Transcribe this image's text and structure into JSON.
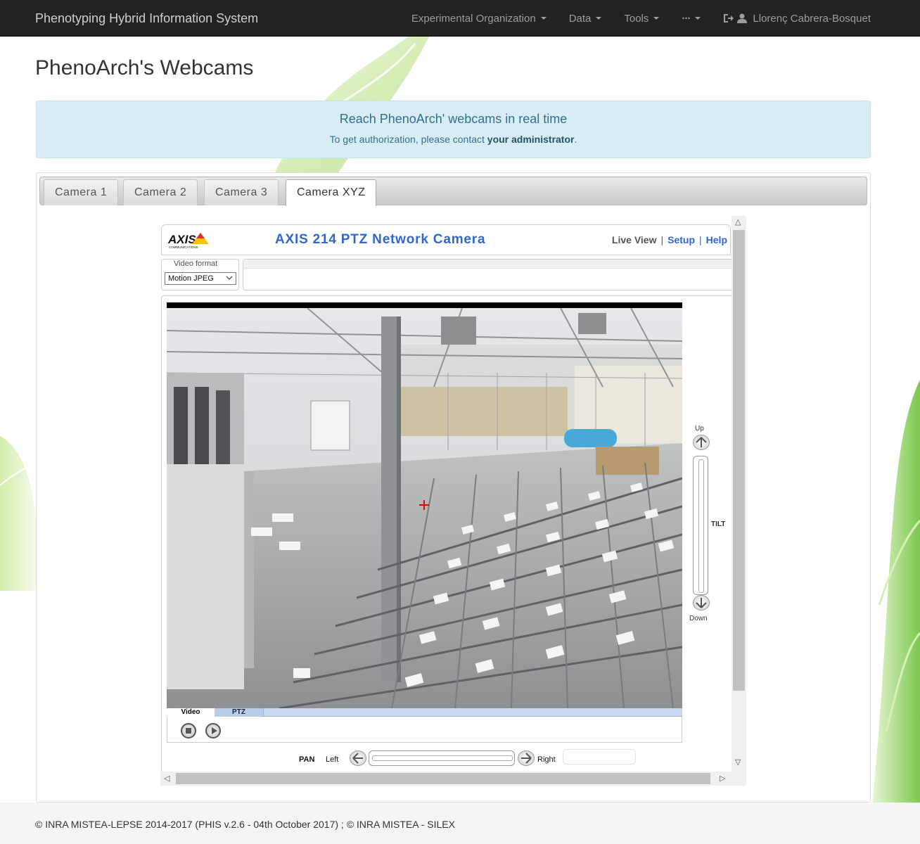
{
  "navbar": {
    "brand": "Phenotyping Hybrid Information System",
    "items": [
      {
        "label": "Experimental Organization"
      },
      {
        "label": "Data"
      },
      {
        "label": "Tools"
      },
      {
        "label": "···"
      }
    ],
    "user": "Llorenç Cabrera-Bosquet"
  },
  "page": {
    "title": "PhenoArch's Webcams"
  },
  "alert": {
    "title": "Reach PhenoArch' webcams in real time",
    "text_before": "To get authorization, please contact ",
    "text_bold": "your administrator",
    "text_after": "."
  },
  "tabs": [
    "Camera 1",
    "Camera 2",
    "Camera 3",
    "Camera XYZ"
  ],
  "active_tab": "Camera XYZ",
  "camera": {
    "logo": "AXIS",
    "logo_sub": "COMMUNICATIONS",
    "title": "AXIS 214 PTZ Network Camera",
    "links": {
      "live": "Live View",
      "setup": "Setup",
      "help": "Help"
    },
    "video_format_label": "Video format",
    "video_format_value": "Motion JPEG",
    "video_tabs": {
      "video": "Video",
      "ptz": "PTZ"
    },
    "tilt": {
      "up": "Up",
      "label": "TILT",
      "down": "Down"
    },
    "pan": {
      "label": "PAN",
      "left": "Left",
      "right": "Right"
    }
  },
  "footer": {
    "text": "© INRA MISTEA-LEPSE 2014-2017 (PHIS v.2.6 - 04th October 2017) ; © INRA MISTEA - SILEX"
  },
  "colors": {
    "navbar_bg": "#222222",
    "alert_bg": "#d9edf7",
    "alert_text": "#31708f",
    "axis_blue": "#3366cc"
  }
}
